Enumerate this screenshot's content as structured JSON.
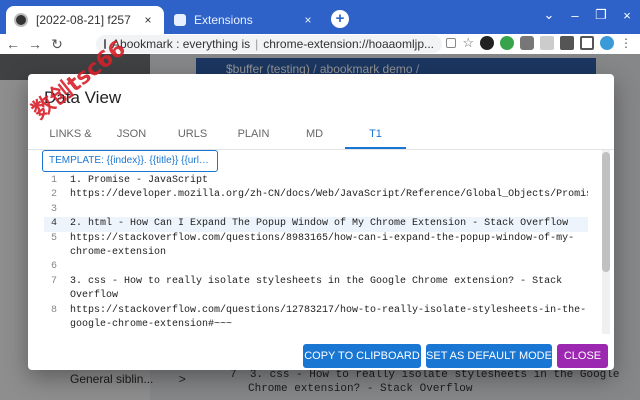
{
  "browser": {
    "tabs": [
      {
        "title": "[2022-08-21] f257",
        "close": "×"
      },
      {
        "title": "Extensions",
        "close": "×"
      }
    ],
    "new_tab": "+",
    "window_controls": [
      "⌄",
      "–",
      "❐",
      "×"
    ],
    "nav": {
      "back": "←",
      "forward": "→",
      "reload": "↻"
    },
    "omnibox": {
      "left": "Abookmark : everything is",
      "right": "chrome-extension://hoaaomljp..."
    },
    "extension_icons": [
      "star-icon",
      "extension-a-icon",
      "extension-b-icon",
      "extension-c-icon",
      "extension-d-icon",
      "puzzle-icon",
      "sidepanel-icon",
      "profile-avatar-icon",
      "menu-dots-icon"
    ]
  },
  "background": {
    "breadcrumb": {
      "first": "$buffer (testing)",
      "sep": "/",
      "second": "abookmark demo",
      "trailing_sep": "/"
    },
    "sidebar_item": "General siblin...",
    "sidebar_chevron": ">",
    "code_line_num": "7",
    "code_line": "3. css - How to really isolate stylesheets in the Google",
    "code_line_2": "Chrome extension? - Stack Overflow"
  },
  "dialog": {
    "title": "Data View",
    "tabs": [
      "LINKS &",
      "JSON",
      "URLS",
      "PLAIN",
      "MD",
      "T1"
    ],
    "active_tab": "T1",
    "template_chip": "TEMPLATE: {{index}}. {{title}} {{url}} ...",
    "lines": [
      {
        "n": "1",
        "text": "1. Promise - JavaScript"
      },
      {
        "n": "2",
        "text": "https://developer.mozilla.org/zh-CN/docs/Web/JavaScript/Reference/Global_Objects/Promise"
      },
      {
        "n": "3",
        "text": ""
      },
      {
        "n": "4",
        "text": "2. html - How Can I Expand The Popup Window of My Chrome Extension - Stack Overflow",
        "highlight": true
      },
      {
        "n": "5",
        "text": "https://stackoverflow.com/questions/8983165/how-can-i-expand-the-popup-window-of-my-"
      },
      {
        "n": "",
        "text": "chrome-extension"
      },
      {
        "n": "6",
        "text": ""
      },
      {
        "n": "7",
        "text": "3. css - How to really isolate stylesheets in the Google Chrome extension? - Stack"
      },
      {
        "n": "",
        "text": "Overflow"
      },
      {
        "n": "8",
        "text": "https://stackoverflow.com/questions/12783217/how-to-really-isolate-stylesheets-in-the-"
      },
      {
        "n": "",
        "text": "google-chrome-extension#~~~"
      }
    ],
    "buttons": {
      "copy": "COPY TO CLIPBOARD",
      "set_default": "SET AS DEFAULT MODE",
      "close": "CLOSE"
    }
  },
  "watermark": "数创tsc66",
  "colors": {
    "primary": "#1976d2",
    "close": "#9c27b0",
    "chrome": "#2f62c8"
  }
}
